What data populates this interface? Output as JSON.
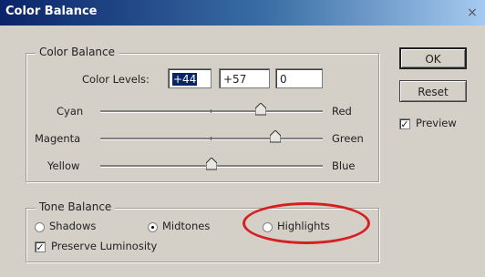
{
  "window": {
    "title": "Color Balance",
    "close_symbol": "×"
  },
  "color_balance": {
    "legend": "Color Balance",
    "levels_label": "Color Levels:",
    "levels": [
      "+44",
      "+57",
      "0"
    ],
    "sliders": [
      {
        "left": "Cyan",
        "right": "Red",
        "value": 44
      },
      {
        "left": "Magenta",
        "right": "Green",
        "value": 57
      },
      {
        "left": "Yellow",
        "right": "Blue",
        "value": 0
      }
    ]
  },
  "tone_balance": {
    "legend": "Tone Balance",
    "options": [
      "Shadows",
      "Midtones",
      "Highlights"
    ],
    "selected": "Midtones",
    "preserve_luminosity": {
      "label": "Preserve Luminosity",
      "checked": true
    }
  },
  "buttons": {
    "ok": "OK",
    "reset": "Reset"
  },
  "preview": {
    "label": "Preview",
    "checked": true
  },
  "annotation": {
    "color": "#d42020",
    "circled_option": "Highlights"
  }
}
